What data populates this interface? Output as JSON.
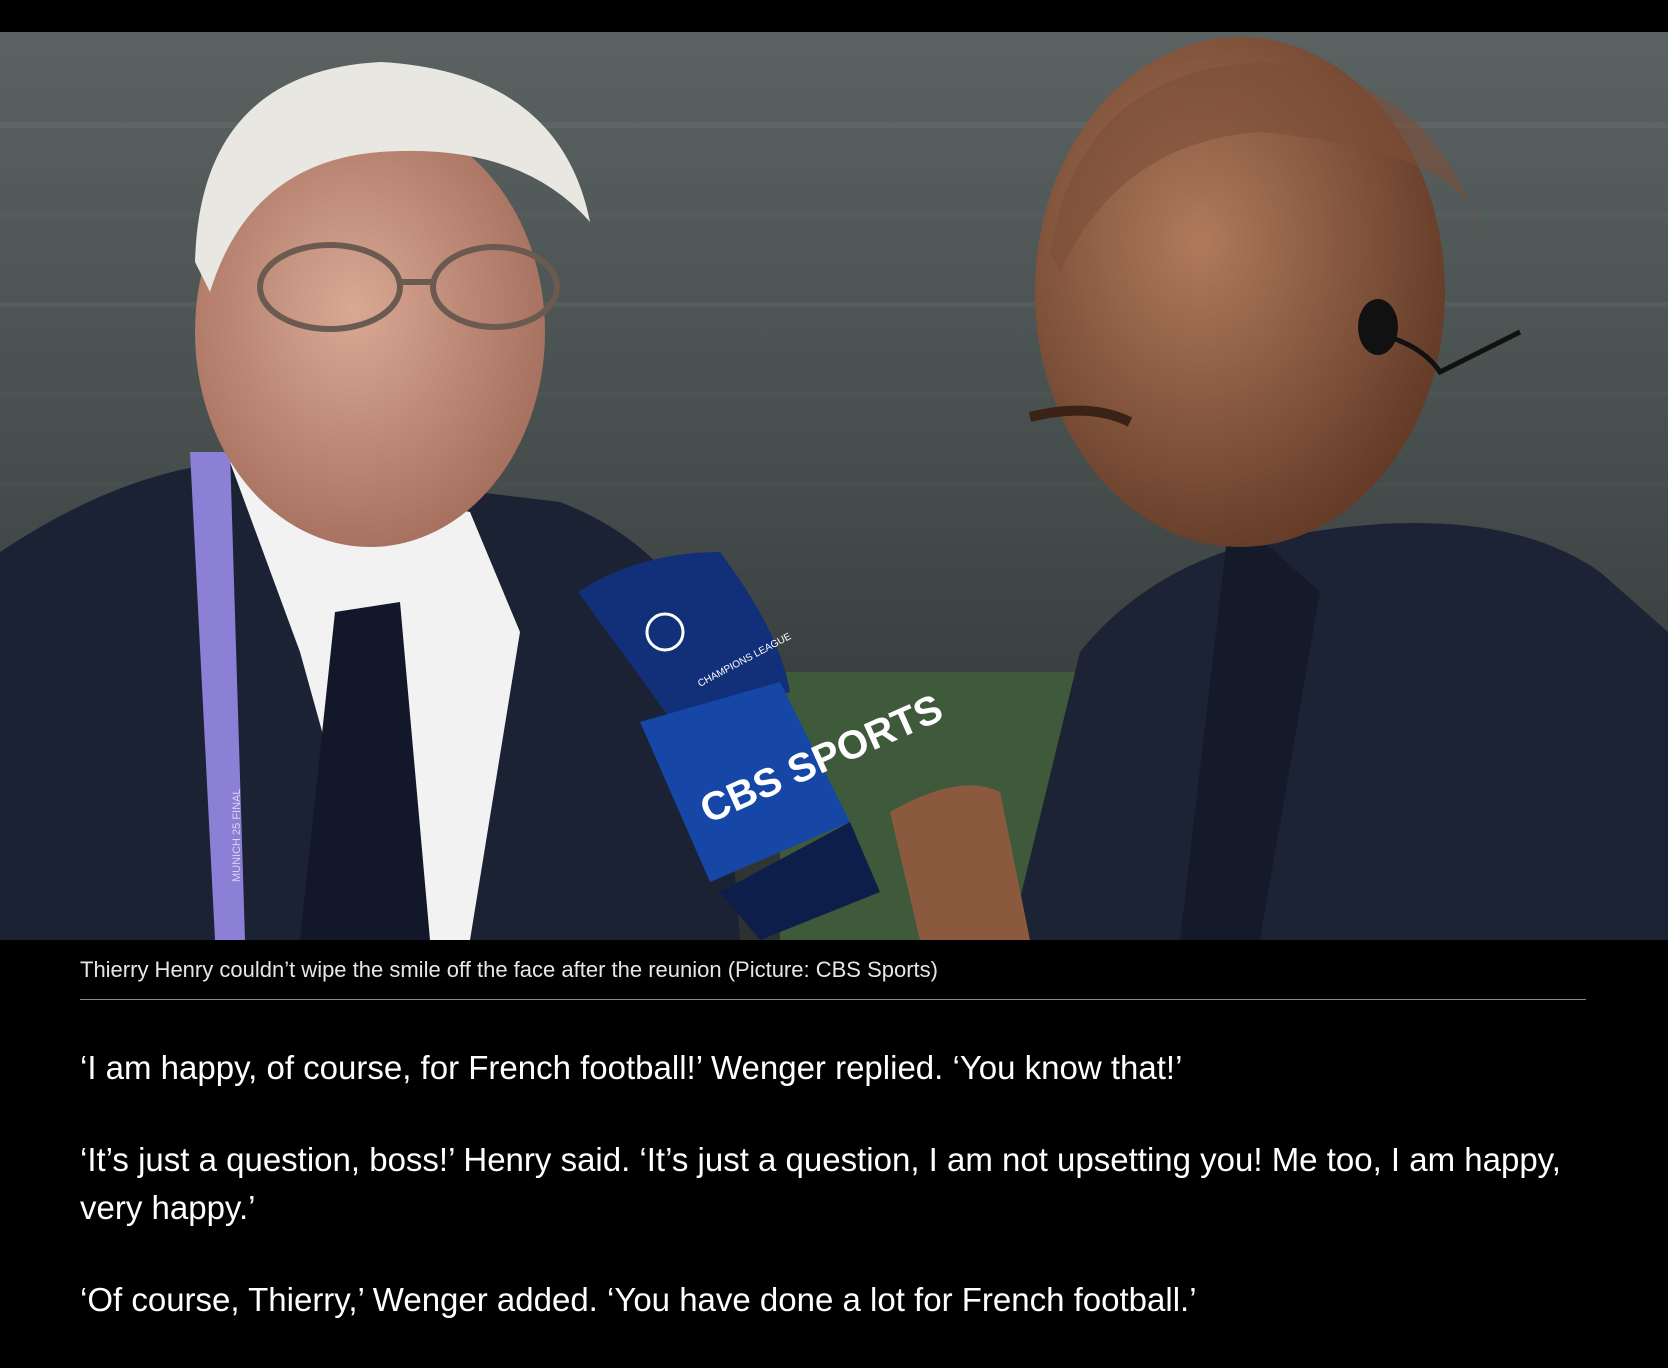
{
  "photo": {
    "alt": "",
    "mic_badge": "CHAMPIONS LEAGUE",
    "mic_logo": "CBS SPORTS",
    "lanyard_text": "MUNICH 25 FINAL",
    "colors": {
      "mic_blue": "#1747a6",
      "suit_navy": "#1b2234",
      "crowd": "#4a5152",
      "pitch": "#3e5a3a"
    }
  },
  "caption": "Thierry Henry couldn’t wipe the smile off the face after the reunion (Picture: CBS Sports)",
  "paragraphs": [
    "‘I am happy, of course, for French football!’ Wenger replied. ‘You know that!’",
    "‘It’s just a question, boss!’ Henry said. ‘It’s just a question, I am not upsetting you! Me too, I am happy, very happy.’",
    "‘Of course, Thierry,’ Wenger added. ‘You have done a lot for French football.’"
  ]
}
